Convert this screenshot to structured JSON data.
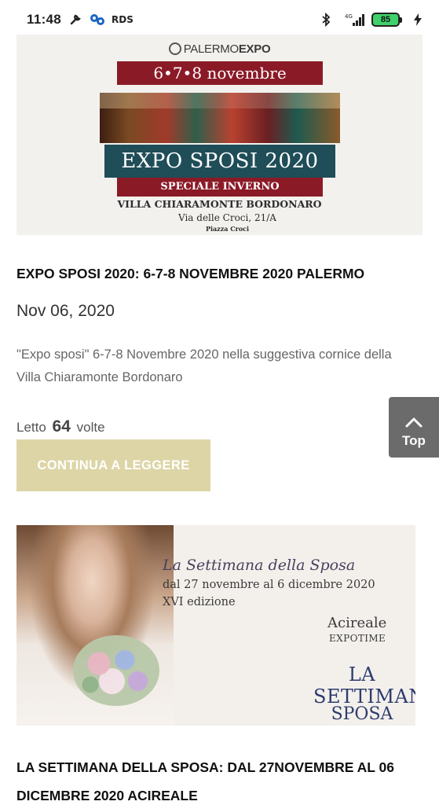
{
  "status_bar": {
    "time": "11:48",
    "rds": "RDS",
    "network": "4G",
    "battery": "85"
  },
  "articles": [
    {
      "banner": {
        "logo_light": "PALERMO",
        "logo_bold": "EXPO",
        "dates": "6•7•8 novembre",
        "title": "EXPO SPOSI 2020",
        "subtitle": "SPECIALE INVERNO",
        "venue": "VILLA CHIARAMONTE BORDONARO",
        "address": "Via delle Croci, 21/A",
        "square": "Piazza Croci"
      },
      "title": "EXPO SPOSI 2020: 6-7-8 NOVEMBRE 2020 PALERMO",
      "date": "Nov 06, 2020",
      "excerpt": "\"Expo sposi\" 6-7-8 Novembre 2020 nella suggestiva cornice della Villa Chiaramonte Bordonaro",
      "reads_prefix": "Letto",
      "reads_count": "64",
      "reads_suffix": "volte",
      "read_more": "CONTINUA A LEGGERE"
    },
    {
      "banner": {
        "line1": "La Settimana della Sposa",
        "line2": "dal 27 novembre al 6 dicembre 2020",
        "line3": "XVI edizione",
        "city": "Acireale",
        "venue": "EXPOTIME",
        "logo_line1": "LA SETTIMANA",
        "logo_line2": "SPOSA"
      },
      "title": "LA SETTIMANA DELLA SPOSA: DAL 27NOVEMBRE AL 06 DICEMBRE 2020 ACIREALE"
    }
  ],
  "top_button": {
    "label": "Top",
    "icon": "chevron-up-icon"
  },
  "colors": {
    "read_more_bg": "#ddd5a6",
    "top_button_bg": "#6b6b6b",
    "banner_red": "#8b1a27",
    "banner_teal": "#1f4d58"
  }
}
